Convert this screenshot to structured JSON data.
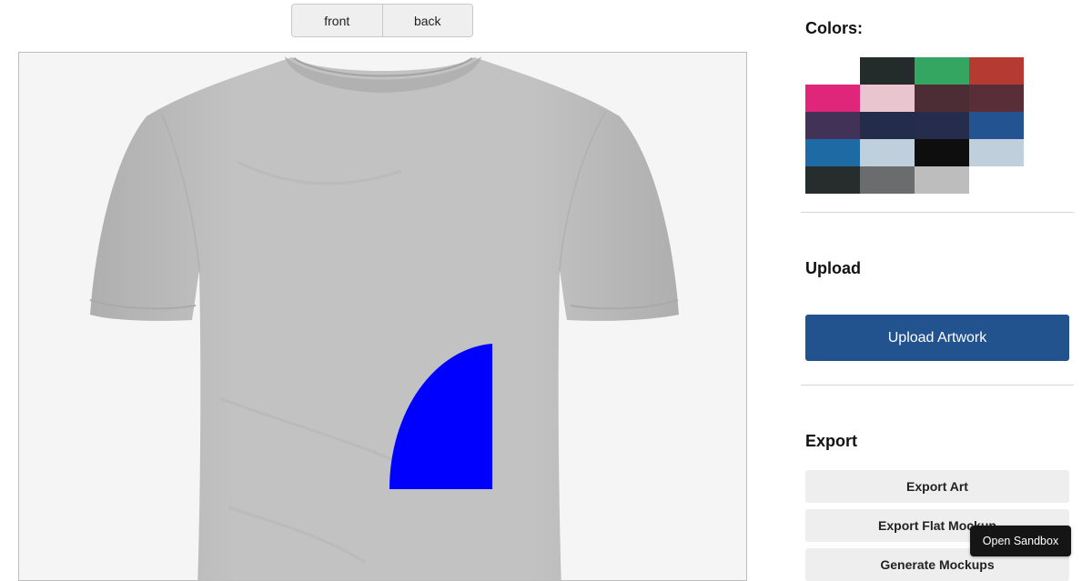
{
  "view_toggle": {
    "front_label": "front",
    "back_label": "back"
  },
  "colors": {
    "title": "Colors:",
    "swatches": [
      "#ffffff",
      "#232b2b",
      "#35a661",
      "#b43a32",
      "#e0267a",
      "#e9c5cf",
      "#4c2d35",
      "#5a2e39",
      "#433257",
      "#242c4c",
      "#262c4c",
      "#235390",
      "#1e6aa5",
      "#bfcfdc",
      "#0e0e0e",
      "#bfcfdc",
      "#252d2d",
      "#6b6c6e",
      "#bdbdbd"
    ]
  },
  "upload": {
    "title": "Upload",
    "button_label": "Upload Artwork"
  },
  "export": {
    "title": "Export",
    "export_art_label": "Export Art",
    "export_flat_mockup_label": "Export Flat Mockup",
    "generate_mockups_label": "Generate Mockups"
  },
  "sandbox": {
    "label": "Open Sandbox"
  },
  "design": {
    "shirt_color": "#bdbdbd",
    "artwork_color": "#0000ff",
    "view": "front"
  }
}
